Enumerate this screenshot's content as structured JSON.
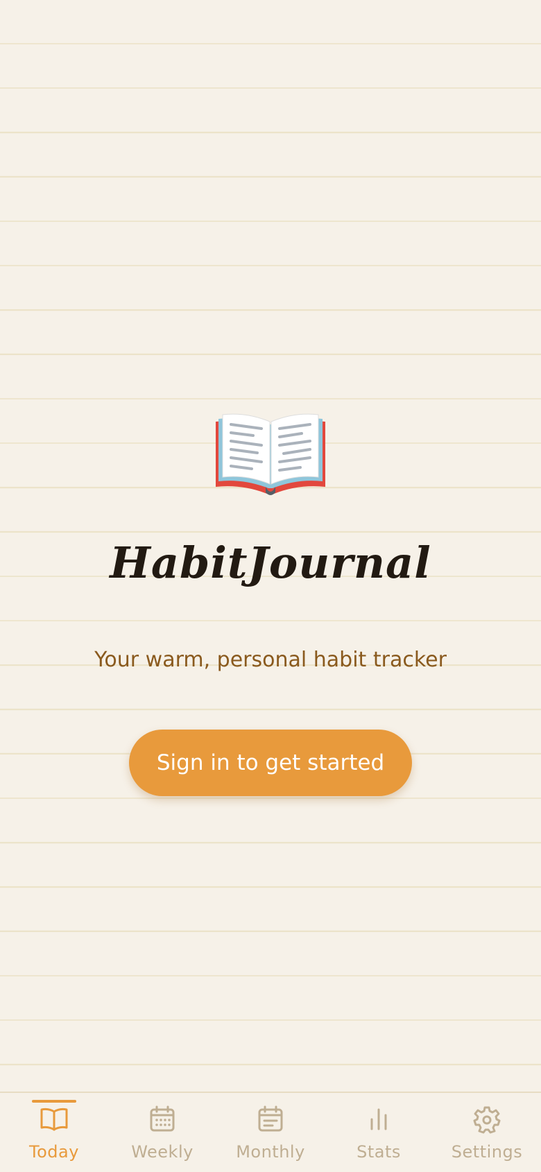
{
  "app": {
    "title": "HabitJournal",
    "tagline": "Your warm, personal habit tracker",
    "signin_label": "Sign in to get started",
    "logo_icon": "open-book-icon"
  },
  "colors": {
    "background": "#f6f1e8",
    "accent": "#e89a3c",
    "tagline": "#8a5a1e",
    "title": "#221a12",
    "inactive_tab": "#bfae92"
  },
  "tabs": [
    {
      "label": "Today",
      "icon": "open-book-icon",
      "active": true
    },
    {
      "label": "Weekly",
      "icon": "calendar-grid-icon",
      "active": false
    },
    {
      "label": "Monthly",
      "icon": "calendar-list-icon",
      "active": false
    },
    {
      "label": "Stats",
      "icon": "bar-chart-icon",
      "active": false
    },
    {
      "label": "Settings",
      "icon": "gear-icon",
      "active": false
    }
  ]
}
